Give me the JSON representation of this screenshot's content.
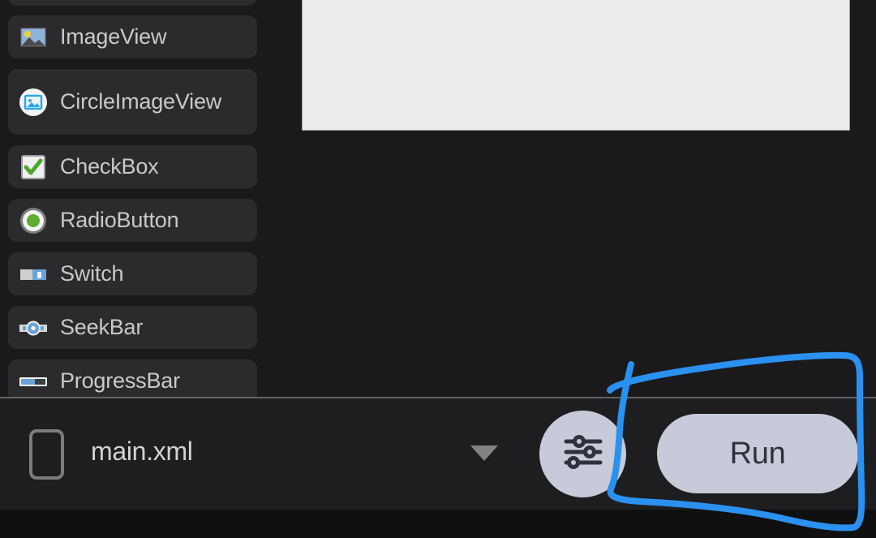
{
  "app": {
    "background_color": "#1a1a1c",
    "accent_color": "#2196f3"
  },
  "palette": {
    "name": "widget-palette-list",
    "items": [
      {
        "label": "",
        "icon": "partial-item-icon",
        "partial": true
      },
      {
        "label": "ImageView",
        "icon": "image-view-icon"
      },
      {
        "label": "CircleImageView",
        "icon": "circle-image-view-icon"
      },
      {
        "label": "CheckBox",
        "icon": "checkbox-icon"
      },
      {
        "label": "RadioButton",
        "icon": "radio-button-icon"
      },
      {
        "label": "Switch",
        "icon": "switch-icon"
      },
      {
        "label": "SeekBar",
        "icon": "seekbar-icon"
      },
      {
        "label": "ProgressBar",
        "icon": "progressbar-icon"
      }
    ]
  },
  "preview": {
    "name": "layout-preview-panel",
    "background_color": "#ececec",
    "border_color": "#9a9a9a"
  },
  "toolbar": {
    "device_icon": "device-phone-icon",
    "file_name": "main.xml",
    "dropdown_icon": "chevron-down-icon",
    "settings_icon": "tune-sliders-icon",
    "run_label": "Run",
    "button_color": "#c7cbd9",
    "run_text_color": "#2e323c"
  },
  "annotation": {
    "name": "handdrawn-highlight-loop",
    "color": "#2b91f0",
    "stroke_width": 8,
    "target": "Run"
  }
}
